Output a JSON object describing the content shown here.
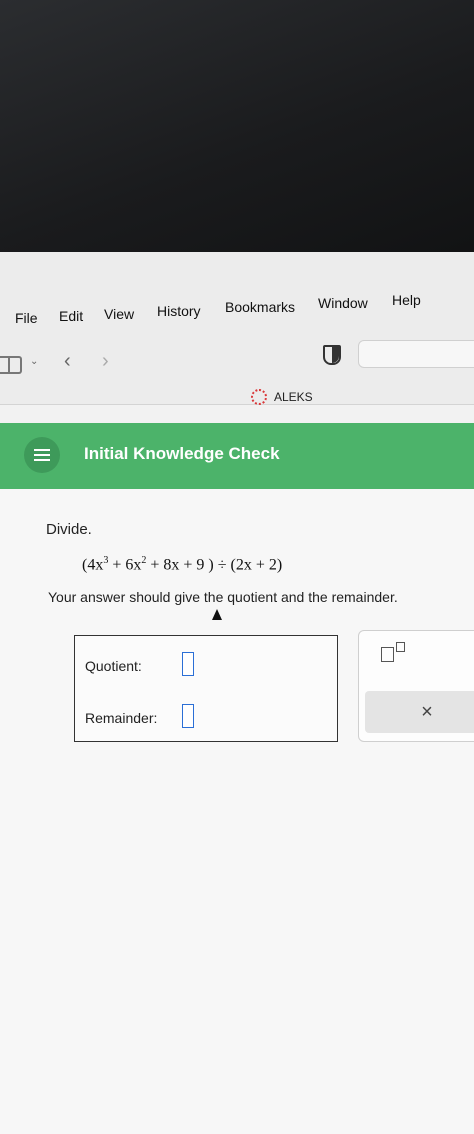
{
  "menubar": {
    "items": [
      "File",
      "Edit",
      "View",
      "History",
      "Bookmarks",
      "Window",
      "Help"
    ]
  },
  "browser": {
    "tab_title": "ALEKS"
  },
  "header": {
    "title": "Initial Knowledge Check"
  },
  "problem": {
    "prompt": "Divide.",
    "expression_parts": {
      "a": "4x",
      "a_exp": "3",
      "b": "+ 6x",
      "b_exp": "2",
      "rest": " + 8x + 9 ) ÷ (2x + 2)"
    },
    "instruction": "Your answer should give the quotient and the remainder.",
    "quotient_label": "Quotient:",
    "remainder_label": "Remainder:"
  },
  "tools": {
    "clear_symbol": "×"
  },
  "colors": {
    "header_green": "#4cb36a",
    "input_border": "#2b6fd6"
  }
}
